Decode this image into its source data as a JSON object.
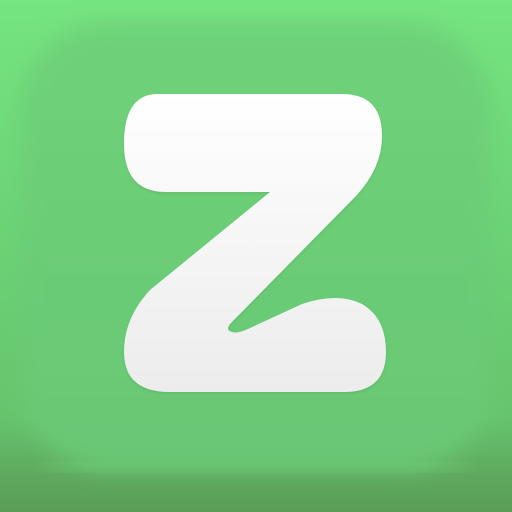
{
  "app_icon": {
    "glyph": "Z",
    "icon_name": "z-logo-icon",
    "colors": {
      "background_top": "#74e57f",
      "background_bottom": "#5a9d58",
      "tile": "#6ccb76",
      "glyph_fill_top": "#ffffff",
      "glyph_fill_bottom": "#ececec"
    }
  }
}
